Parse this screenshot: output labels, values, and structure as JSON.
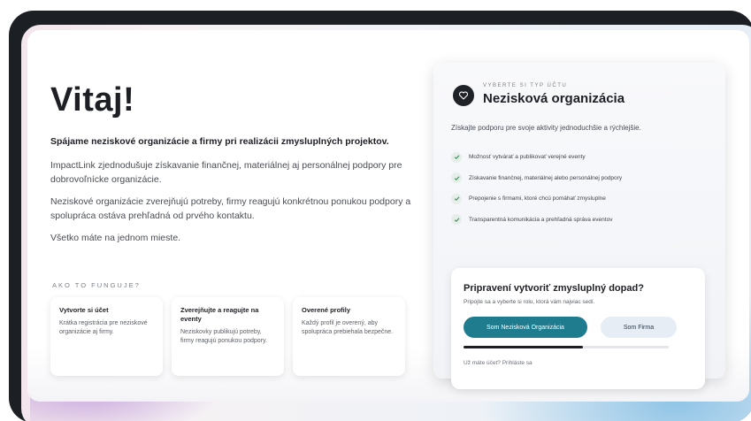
{
  "hero": {
    "title": "Vitaj!",
    "lead": "Spájame neziskové organizácie a firmy pri realizácii zmysluplných projektov.",
    "p1": "ImpactLink zjednodušuje získavanie finančnej, materiálnej aj personálnej podpory pre dobrovoľnícke organizácie.",
    "p2": "Neziskové organizácie zverejňujú potreby, firmy reagujú konkrétnou ponukou podpory a spolupráca ostáva prehľadná od prvého kontaktu.",
    "p3": "Všetko máte na jednom mieste."
  },
  "how": {
    "label": "AKO TO FUNGUJE?",
    "steps": [
      {
        "title": "Vytvorte si účet",
        "text": "Krátka registrácia pre neziskové organizácie aj firmy."
      },
      {
        "title": "Zverejňujte a reagujte na eventy",
        "text": "Neziskovky publikujú potreby, firmy reagujú ponukou podpory."
      },
      {
        "title": "Overené profily",
        "text": "Každý profil je overený, aby spolupráca prebiehala bezpečne."
      }
    ]
  },
  "panel": {
    "kicker": "VYBERTE SI TYP ÚČTU",
    "title": "Nezisková organizácia",
    "desc": "Získajte podporu pre svoje aktivity jednoduchšie a rýchlejšie.",
    "benefits": [
      "Možnosť vytvárať a publikovať verejné eventy",
      "Získavanie finančnej, materiálnej alebo personálnej podpory",
      "Prepojenie s firmami, ktoré chcú pomáhať zmysluplne",
      "Transparentná komunikácia a prehľadná správa eventov"
    ],
    "cta": {
      "title": "Pripravení vytvoriť zmysluplný dopad?",
      "sub": "Pripojte sa a vyberte si rolu, ktorá vám najviac sedí.",
      "primary": "Som Nezisková Organizácia",
      "secondary": "Som Firma",
      "progress": 0.58,
      "login": "Už máte účet? Prihláste sa"
    }
  },
  "colors": {
    "accent": "#1f7c8e",
    "frame": "#1c1f24",
    "text": "#1d1f24"
  },
  "icons": {
    "panel": "heart-badge-icon",
    "benefit": "check-icon"
  }
}
